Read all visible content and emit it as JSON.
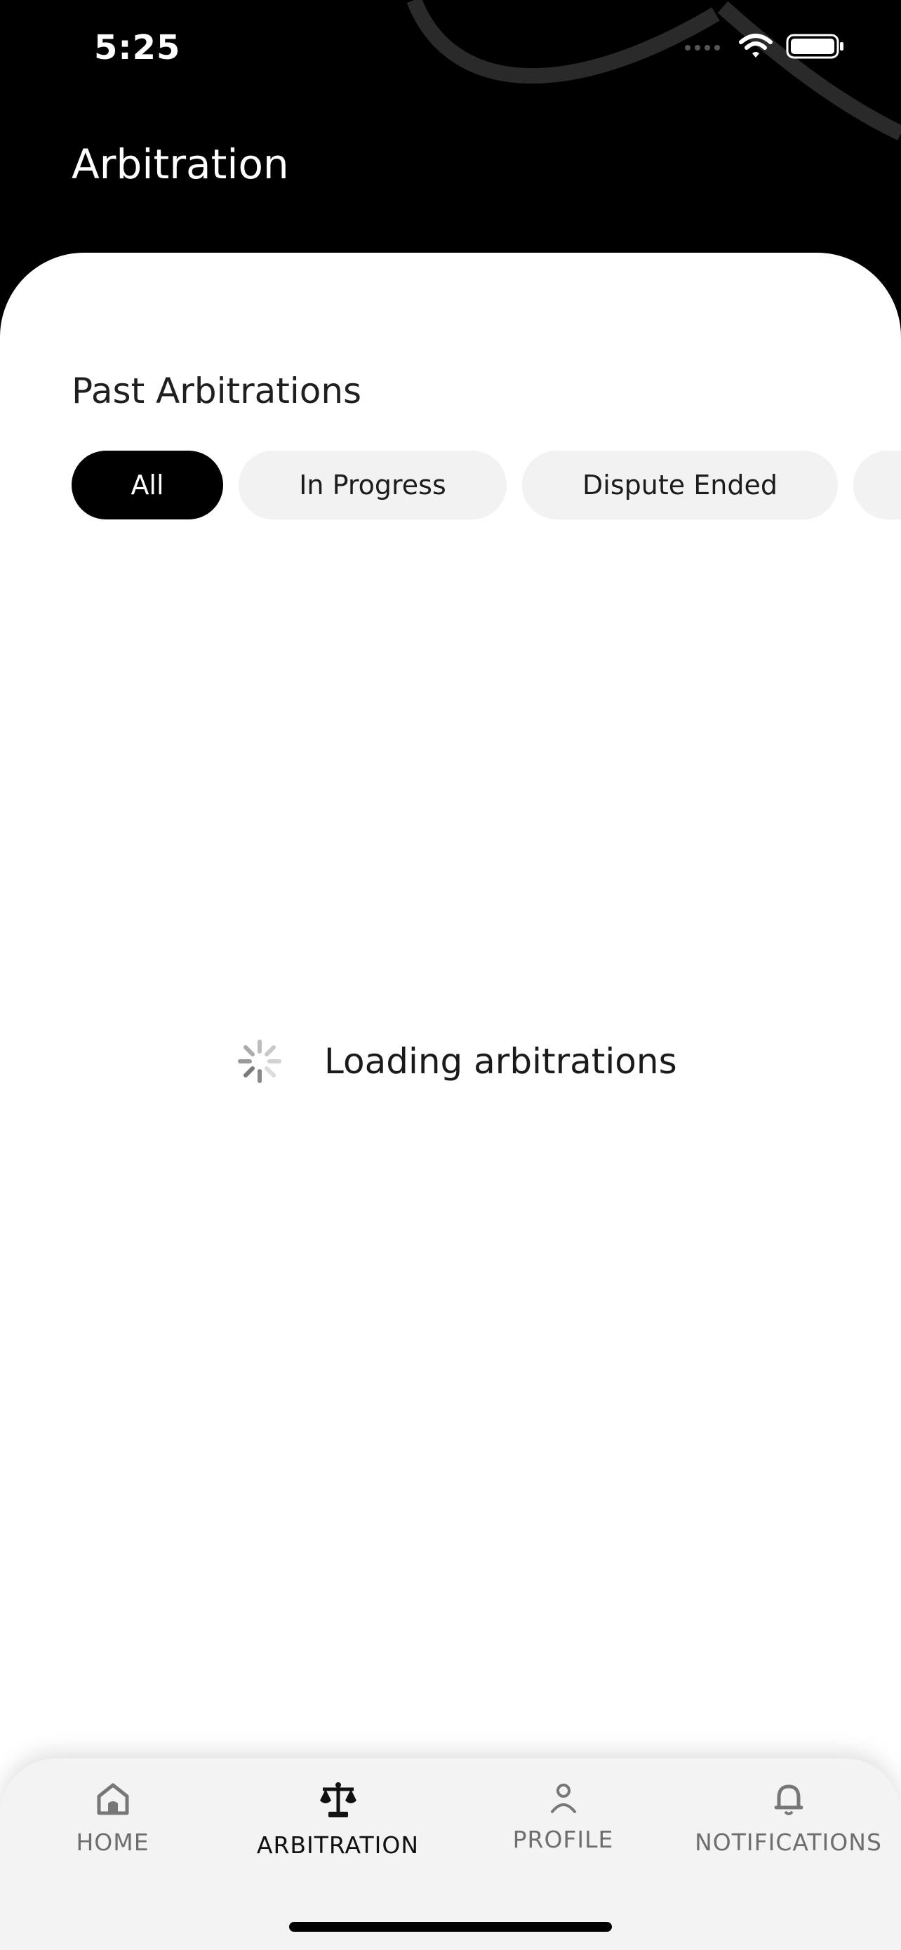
{
  "status_bar": {
    "time": "5:25"
  },
  "header": {
    "title": "Arbitration"
  },
  "section": {
    "title": "Past Arbitrations"
  },
  "filters": [
    {
      "label": "All",
      "selected": true
    },
    {
      "label": "In Progress",
      "selected": false
    },
    {
      "label": "Dispute Ended",
      "selected": false
    },
    {
      "label": "",
      "selected": false
    }
  ],
  "loading": {
    "text": "Loading arbitrations"
  },
  "tabbar": {
    "items": [
      {
        "label": "HOME",
        "icon": "home-icon",
        "active": false
      },
      {
        "label": "ARBITRATION",
        "icon": "scales-icon",
        "active": true
      },
      {
        "label": "PROFILE",
        "icon": "person-icon",
        "active": false
      },
      {
        "label": "NOTIFICATIONS",
        "icon": "bell-icon",
        "active": false
      }
    ]
  },
  "colors": {
    "header_bg": "#000000",
    "card_bg": "#ffffff",
    "chip_active_bg": "#000000",
    "chip_bg": "#f2f2f2",
    "tabbar_bg": "#f3f3f3"
  }
}
